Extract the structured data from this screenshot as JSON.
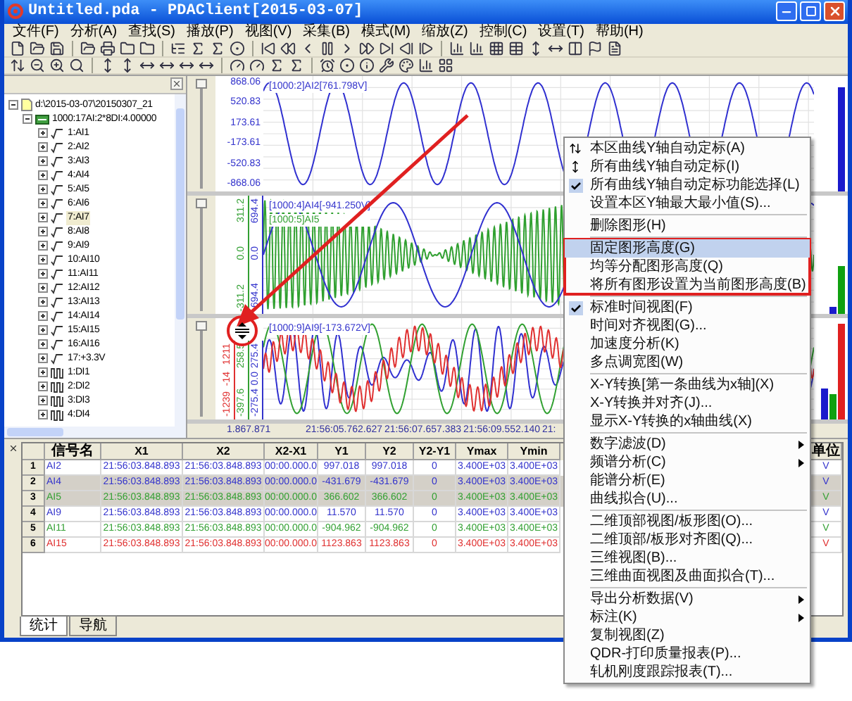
{
  "window": {
    "title": "Untitled.pda - PDAClient[2015-03-07]"
  },
  "menubar": [
    "文件(F)",
    "分析(A)",
    "查找(S)",
    "播放(P)",
    "视图(V)",
    "采集(B)",
    "模式(M)",
    "缩放(Z)",
    "控制(C)",
    "设置(T)",
    "帮助(H)"
  ],
  "tree": {
    "label": "d:\\2015-03-07\\20150307_21",
    "expanded": true,
    "children": [
      {
        "label": "1000:17AI:2*8DI:4.00000",
        "expanded": true,
        "children": [
          {
            "label": "1:AI1",
            "kind": "analog",
            "expanded": false,
            "selected": false
          },
          {
            "label": "2:AI2",
            "kind": "analog",
            "expanded": false,
            "selected": false
          },
          {
            "label": "3:AI3",
            "kind": "analog",
            "expanded": false,
            "selected": false
          },
          {
            "label": "4:AI4",
            "kind": "analog",
            "expanded": false,
            "selected": false
          },
          {
            "label": "5:AI5",
            "kind": "analog",
            "expanded": false,
            "selected": false
          },
          {
            "label": "6:AI6",
            "kind": "analog",
            "expanded": false,
            "selected": false
          },
          {
            "label": "7:AI7",
            "kind": "analog",
            "expanded": false,
            "selected": true
          },
          {
            "label": "8:AI8",
            "kind": "analog",
            "expanded": false,
            "selected": false
          },
          {
            "label": "9:AI9",
            "kind": "analog",
            "expanded": false,
            "selected": false
          },
          {
            "label": "10:AI10",
            "kind": "analog",
            "expanded": false,
            "selected": false
          },
          {
            "label": "11:AI11",
            "kind": "analog",
            "expanded": false,
            "selected": false
          },
          {
            "label": "12:AI12",
            "kind": "analog",
            "expanded": false,
            "selected": false
          },
          {
            "label": "13:AI13",
            "kind": "analog",
            "expanded": false,
            "selected": false
          },
          {
            "label": "14:AI14",
            "kind": "analog",
            "expanded": false,
            "selected": false
          },
          {
            "label": "15:AI15",
            "kind": "analog",
            "expanded": false,
            "selected": false
          },
          {
            "label": "16:AI16",
            "kind": "analog",
            "expanded": false,
            "selected": false
          },
          {
            "label": "17:+3.3V",
            "kind": "analog",
            "expanded": false,
            "selected": false
          },
          {
            "label": "1:DI1",
            "kind": "digital",
            "expanded": false,
            "selected": false
          },
          {
            "label": "2:DI2",
            "kind": "digital",
            "expanded": false,
            "selected": false
          },
          {
            "label": "3:DI3",
            "kind": "digital",
            "expanded": false,
            "selected": false
          },
          {
            "label": "4:DI4",
            "kind": "digital",
            "expanded": false,
            "selected": false
          }
        ]
      }
    ]
  },
  "charts": [
    {
      "slider": {
        "level": 1
      },
      "axes": [
        {
          "kind": "horizontal",
          "color": "#3333cc",
          "labels": [
            "868.06",
            "520.83",
            "173.61",
            "-173.61",
            "-520.83",
            "-868.06"
          ]
        }
      ],
      "legends": [
        {
          "text": "[1000:2]AI2[761.798V]",
          "color": "#3333cc"
        }
      ],
      "meters": [
        {
          "color": "#1a1acc",
          "level": 0.9
        }
      ]
    },
    {
      "slider": {
        "level": 1
      },
      "axes": [
        {
          "kind": "rotated",
          "color": "#33a033",
          "labels": [
            "311.2",
            "0.0",
            "-311.2"
          ]
        },
        {
          "kind": "rotated",
          "color": "#3333cc",
          "labels": [
            "694.4",
            "0.0",
            "-694.4"
          ]
        }
      ],
      "legends": [
        {
          "text": "[1000:4]AI4[-941.250V]",
          "color": "#3333cc"
        },
        {
          "text": "[1000:5]AI5",
          "color": "#33a033"
        }
      ],
      "meters": [
        {
          "color": "#1a1acc",
          "level": 0.06
        },
        {
          "color": "#10a010",
          "level": 0.4
        }
      ]
    },
    {
      "slider": {
        "level": 1
      },
      "axes": [
        {
          "kind": "rotated",
          "color": "#e03030",
          "labels": [
            "1211",
            "-14",
            "-1239"
          ]
        },
        {
          "kind": "rotated",
          "color": "#33a033",
          "labels": [
            "258.5",
            "-397.6"
          ]
        },
        {
          "kind": "rotated",
          "color": "#3333cc",
          "labels": [
            "275.4",
            "0.0",
            "-275.4"
          ]
        }
      ],
      "legends": [
        {
          "text": "[1000:9]AI9[-173.672V]",
          "color": "#3333cc"
        }
      ],
      "meters": [
        {
          "color": "#1a1acc",
          "level": 0.3
        },
        {
          "color": "#10a010",
          "level": 0.25
        },
        {
          "color": "#e02020",
          "level": 0.95
        }
      ]
    }
  ],
  "time_axis": [
    "1.867.871",
    "21:56:05.762.627",
    "21:56:07.657.383",
    "21:56:09.552.140",
    "21:"
  ],
  "table": {
    "columns": [
      "信号名",
      "X1",
      "X2",
      "X2-X1",
      "Y1",
      "Y2",
      "Y2-Y1",
      "Ymax",
      "Ymin",
      "单位"
    ],
    "rows": [
      {
        "no": "1",
        "color": "#3333cc",
        "selected": false,
        "cells": [
          "AI2",
          "21:56:03.848.893",
          "21:56:03.848.893",
          "00:00.000.0",
          "997.018",
          "997.018",
          "0",
          "3.400E+03",
          "3.400E+03",
          "V"
        ]
      },
      {
        "no": "2",
        "color": "#3333cc",
        "selected": true,
        "cells": [
          "AI4",
          "21:56:03.848.893",
          "21:56:03.848.893",
          "00:00.000.0",
          "-431.679",
          "-431.679",
          "0",
          "3.400E+03",
          "3.400E+03",
          "V"
        ]
      },
      {
        "no": "3",
        "color": "#33a033",
        "selected": true,
        "cells": [
          "AI5",
          "21:56:03.848.893",
          "21:56:03.848.893",
          "00:00.000.0",
          "366.602",
          "366.602",
          "0",
          "3.400E+03",
          "3.400E+03",
          "V"
        ]
      },
      {
        "no": "4",
        "color": "#3333cc",
        "selected": false,
        "cells": [
          "AI9",
          "21:56:03.848.893",
          "21:56:03.848.893",
          "00:00.000.0",
          "11.570",
          "11.570",
          "0",
          "3.400E+03",
          "3.400E+03",
          "V"
        ]
      },
      {
        "no": "5",
        "color": "#33a033",
        "selected": false,
        "cells": [
          "AI11",
          "21:56:03.848.893",
          "21:56:03.848.893",
          "00:00.000.0",
          "-904.962",
          "-904.962",
          "0",
          "3.400E+03",
          "3.400E+03",
          "V"
        ]
      },
      {
        "no": "6",
        "color": "#e03030",
        "selected": false,
        "cells": [
          "AI15",
          "21:56:03.848.893",
          "21:56:03.848.893",
          "00:00.000.0",
          "1123.863",
          "1123.863",
          "0",
          "3.400E+03",
          "3.400E+03",
          "V"
        ]
      }
    ]
  },
  "bottom_tabs": [
    {
      "label": "统计",
      "selected": true
    },
    {
      "label": "导航",
      "selected": false
    }
  ],
  "context_menu": {
    "sections": [
      {
        "framed": false,
        "items": [
          {
            "label": "本区曲线Y轴自动定标(A)",
            "kind": "scale",
            "checked": false,
            "submenu": false,
            "selected": false
          },
          {
            "label": "所有曲线Y轴自动定标(I)",
            "kind": "scaleall",
            "checked": false,
            "submenu": false,
            "selected": false
          },
          {
            "label": "所有曲线Y轴自动定标功能选择(L)",
            "kind": "plain",
            "checked": true,
            "submenu": false,
            "selected": false
          },
          {
            "label": "设置本区Y轴最大最小值(S)...",
            "kind": "plain",
            "checked": false,
            "submenu": false,
            "selected": false
          }
        ]
      },
      {
        "framed": false,
        "items": [
          {
            "label": "删除图形(H)",
            "kind": "plain",
            "checked": false,
            "submenu": false,
            "selected": false
          }
        ]
      },
      {
        "framed": true,
        "items": [
          {
            "label": "固定图形高度(G)",
            "kind": "plain",
            "checked": false,
            "submenu": false,
            "selected": true
          },
          {
            "label": "均等分配图形高度(Q)",
            "kind": "plain",
            "checked": false,
            "submenu": false,
            "selected": false
          },
          {
            "label": "将所有图形设置为当前图形高度(B)",
            "kind": "plain",
            "checked": false,
            "submenu": false,
            "selected": false
          }
        ]
      },
      {
        "framed": false,
        "items": [
          {
            "label": "标准时间视图(F)",
            "kind": "plain",
            "checked": true,
            "submenu": false,
            "selected": false
          },
          {
            "label": "时间对齐视图(G)...",
            "kind": "plain",
            "checked": false,
            "submenu": false,
            "selected": false
          },
          {
            "label": "加速度分析(K)",
            "kind": "plain",
            "checked": false,
            "submenu": false,
            "selected": false
          },
          {
            "label": "多点调宽图(W)",
            "kind": "plain",
            "checked": false,
            "submenu": false,
            "selected": false
          }
        ]
      },
      {
        "framed": false,
        "items": [
          {
            "label": "X-Y转换[第一条曲线为x轴](X)",
            "kind": "plain",
            "checked": false,
            "submenu": false,
            "selected": false
          },
          {
            "label": "X-Y转换并对齐(J)...",
            "kind": "plain",
            "checked": false,
            "submenu": false,
            "selected": false
          },
          {
            "label": "显示X-Y转换的x轴曲线(X)",
            "kind": "plain",
            "checked": false,
            "submenu": false,
            "selected": false
          }
        ]
      },
      {
        "framed": false,
        "items": [
          {
            "label": "数字滤波(D)",
            "kind": "plain",
            "checked": false,
            "submenu": true,
            "selected": false
          },
          {
            "label": "频谱分析(C)",
            "kind": "plain",
            "checked": false,
            "submenu": true,
            "selected": false
          },
          {
            "label": "能谱分析(E)",
            "kind": "plain",
            "checked": false,
            "submenu": false,
            "selected": false
          },
          {
            "label": "曲线拟合(U)...",
            "kind": "plain",
            "checked": false,
            "submenu": false,
            "selected": false
          }
        ]
      },
      {
        "framed": false,
        "items": [
          {
            "label": "二维顶部视图/板形图(O)...",
            "kind": "plain",
            "checked": false,
            "submenu": false,
            "selected": false
          },
          {
            "label": "二维顶部/板形对齐图(Q)...",
            "kind": "plain",
            "checked": false,
            "submenu": false,
            "selected": false
          },
          {
            "label": "三维视图(B)...",
            "kind": "plain",
            "checked": false,
            "submenu": false,
            "selected": false
          },
          {
            "label": "三维曲面视图及曲面拟合(T)...",
            "kind": "plain",
            "checked": false,
            "submenu": false,
            "selected": false
          }
        ]
      },
      {
        "framed": false,
        "items": [
          {
            "label": "导出分析数据(V)",
            "kind": "plain",
            "checked": false,
            "submenu": true,
            "selected": false
          },
          {
            "label": "标注(K)",
            "kind": "plain",
            "checked": false,
            "submenu": true,
            "selected": false
          },
          {
            "label": "复制视图(Z)",
            "kind": "plain",
            "checked": false,
            "submenu": false,
            "selected": false
          },
          {
            "label": "QDR-打印质量报表(P)...",
            "kind": "plain",
            "checked": false,
            "submenu": false,
            "selected": false
          },
          {
            "label": "轧机刚度跟踪报表(T)...",
            "kind": "plain",
            "checked": false,
            "submenu": false,
            "selected": false
          }
        ]
      }
    ]
  }
}
